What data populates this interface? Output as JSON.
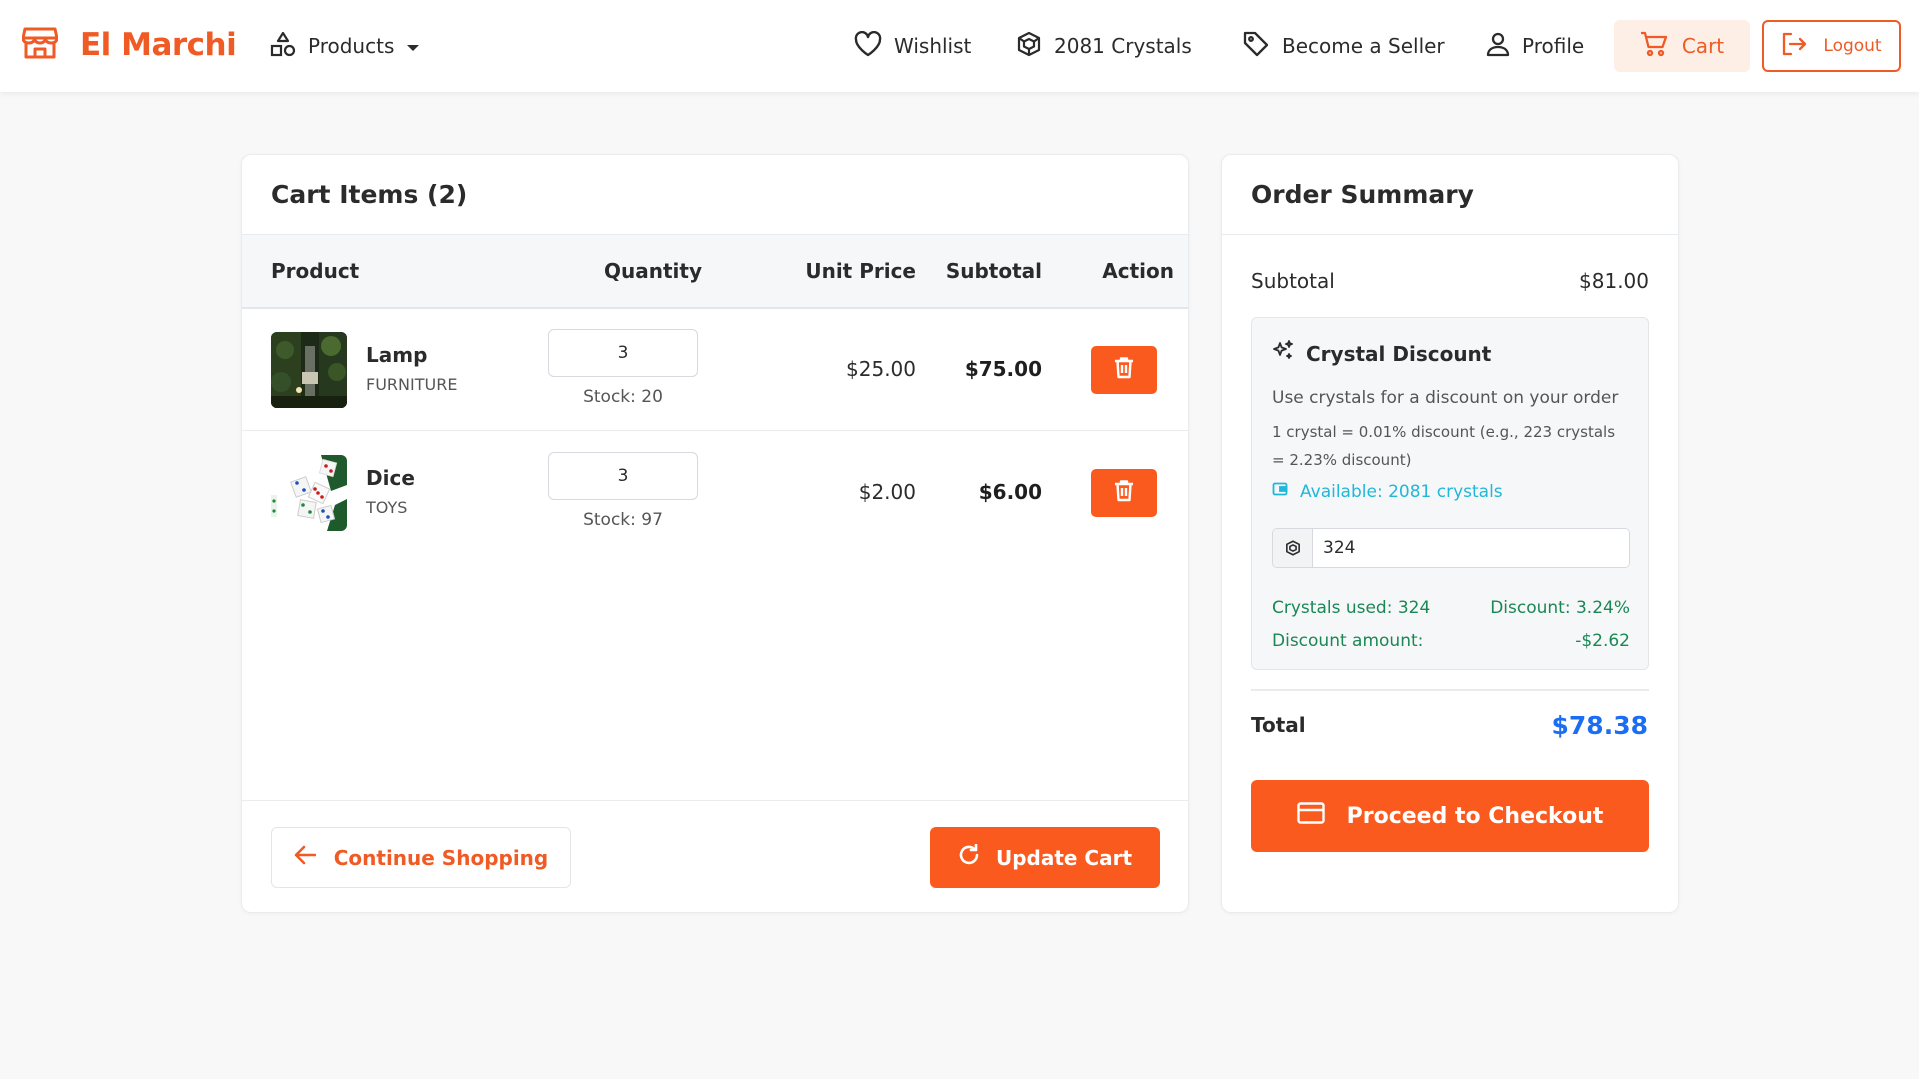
{
  "brand": {
    "name": "El Marchi"
  },
  "nav": {
    "products": "Products",
    "wishlist": "Wishlist",
    "crystals": "2081 Crystals",
    "seller": "Become a Seller",
    "profile": "Profile",
    "cart": "Cart",
    "logout": "Logout"
  },
  "cart": {
    "title": "Cart Items (2)",
    "columns": {
      "product": "Product",
      "quantity": "Quantity",
      "unit_price": "Unit Price",
      "subtotal": "Subtotal",
      "action": "Action"
    },
    "items": [
      {
        "name": "Lamp",
        "category": "FURNITURE",
        "quantity": "3",
        "stock": "Stock: 20",
        "unit_price": "$25.00",
        "subtotal": "$75.00"
      },
      {
        "name": "Dice",
        "category": "TOYS",
        "quantity": "3",
        "stock": "Stock: 97",
        "unit_price": "$2.00",
        "subtotal": "$6.00"
      }
    ],
    "continue_label": "Continue Shopping",
    "update_label": "Update Cart"
  },
  "summary": {
    "title": "Order Summary",
    "subtotal_label": "Subtotal",
    "subtotal_value": "$81.00",
    "crystal": {
      "title": "Crystal Discount",
      "description": "Use crystals for a discount on your order",
      "rate": "1 crystal = 0.01% discount (e.g., 223 crystals = 2.23% discount)",
      "available": "Available: 2081 crystals",
      "input_value": "324",
      "used": "Crystals used: 324",
      "discount_pct": "Discount: 3.24%",
      "amount_label": "Discount amount:",
      "amount_value": "-$2.62"
    },
    "total_label": "Total",
    "total_value": "$78.38",
    "checkout_label": "Proceed to Checkout"
  },
  "colors": {
    "accent": "#fb5a1e",
    "total": "#1b6ef3",
    "available": "#21b7d8",
    "discount": "#1a8754"
  }
}
